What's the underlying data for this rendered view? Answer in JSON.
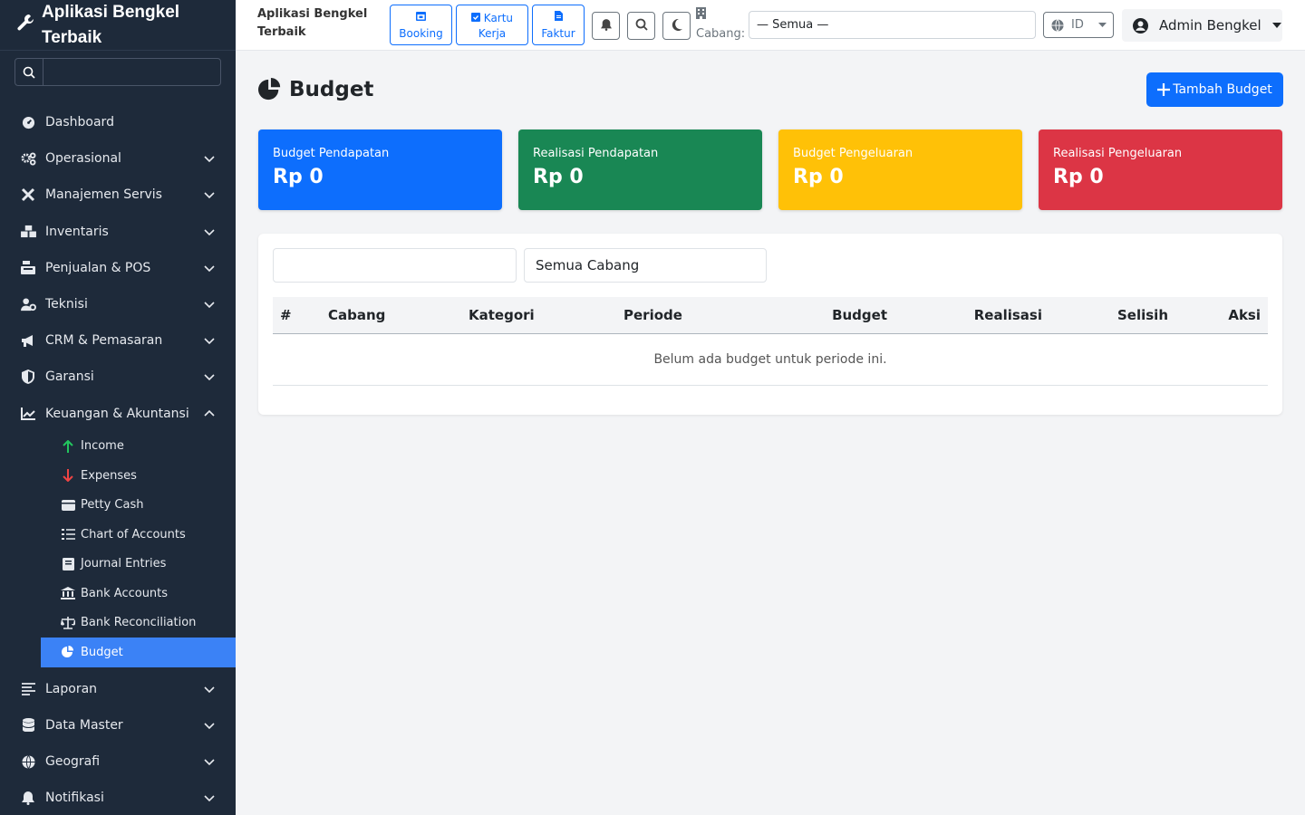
{
  "app": {
    "name": "Aplikasi Bengkel Terbaik"
  },
  "sidebar": {
    "search_placeholder": "",
    "items": [
      {
        "label": "Dashboard",
        "icon": "gauge-icon"
      },
      {
        "label": "Operasional",
        "icon": "gears-icon"
      },
      {
        "label": "Manajemen Servis",
        "icon": "tools-icon"
      },
      {
        "label": "Inventaris",
        "icon": "boxes-icon"
      },
      {
        "label": "Penjualan & POS",
        "icon": "cash-register-icon"
      },
      {
        "label": "Teknisi",
        "icon": "user-gear-icon"
      },
      {
        "label": "CRM & Pemasaran",
        "icon": "bullhorn-icon"
      },
      {
        "label": "Garansi",
        "icon": "shield-icon"
      },
      {
        "label": "Keuangan & Akuntansi",
        "icon": "chart-line-icon"
      },
      {
        "label": "Laporan",
        "icon": "list-icon"
      },
      {
        "label": "Data Master",
        "icon": "database-icon"
      },
      {
        "label": "Geografi",
        "icon": "globe-icon"
      },
      {
        "label": "Notifikasi",
        "icon": "bell-icon"
      }
    ],
    "finance_sub": [
      {
        "label": "Income",
        "icon": "arrow-up-icon",
        "color": "#22c55e"
      },
      {
        "label": "Expenses",
        "icon": "arrow-down-icon",
        "color": "#ef4444"
      },
      {
        "label": "Petty Cash",
        "icon": "wallet-icon"
      },
      {
        "label": "Chart of Accounts",
        "icon": "list-check-icon"
      },
      {
        "label": "Journal Entries",
        "icon": "book-icon"
      },
      {
        "label": "Bank Accounts",
        "icon": "bank-icon"
      },
      {
        "label": "Bank Reconciliation",
        "icon": "scale-icon"
      },
      {
        "label": "Budget",
        "icon": "pie-chart-icon"
      }
    ]
  },
  "topbar": {
    "title": "Aplikasi Bengkel Terbaik",
    "quick": {
      "booking": "Booking",
      "kartu_kerja": "Kartu Kerja",
      "faktur": "Faktur"
    },
    "cabang_label": "Cabang:",
    "cabang_value": "— Semua —",
    "lang": "ID",
    "user": "Admin Bengkel"
  },
  "page": {
    "title": "Budget",
    "add_button": "Tambah Budget",
    "cards": [
      {
        "label": "Budget Pendapatan",
        "value": "Rp 0",
        "color": "#0d6efd"
      },
      {
        "label": "Realisasi Pendapatan",
        "value": "Rp 0",
        "color": "#198754"
      },
      {
        "label": "Budget Pengeluaran",
        "value": "Rp 0",
        "color": "#ffc107"
      },
      {
        "label": "Realisasi Pengeluaran",
        "value": "Rp 0",
        "color": "#dc3545"
      }
    ],
    "filter": {
      "period_value": "",
      "cabang_value": "Semua Cabang"
    },
    "table": {
      "headers": [
        "#",
        "Cabang",
        "Kategori",
        "Periode",
        "Budget",
        "Realisasi",
        "Selisih",
        "Aksi"
      ],
      "empty": "Belum ada budget untuk periode ini."
    }
  }
}
